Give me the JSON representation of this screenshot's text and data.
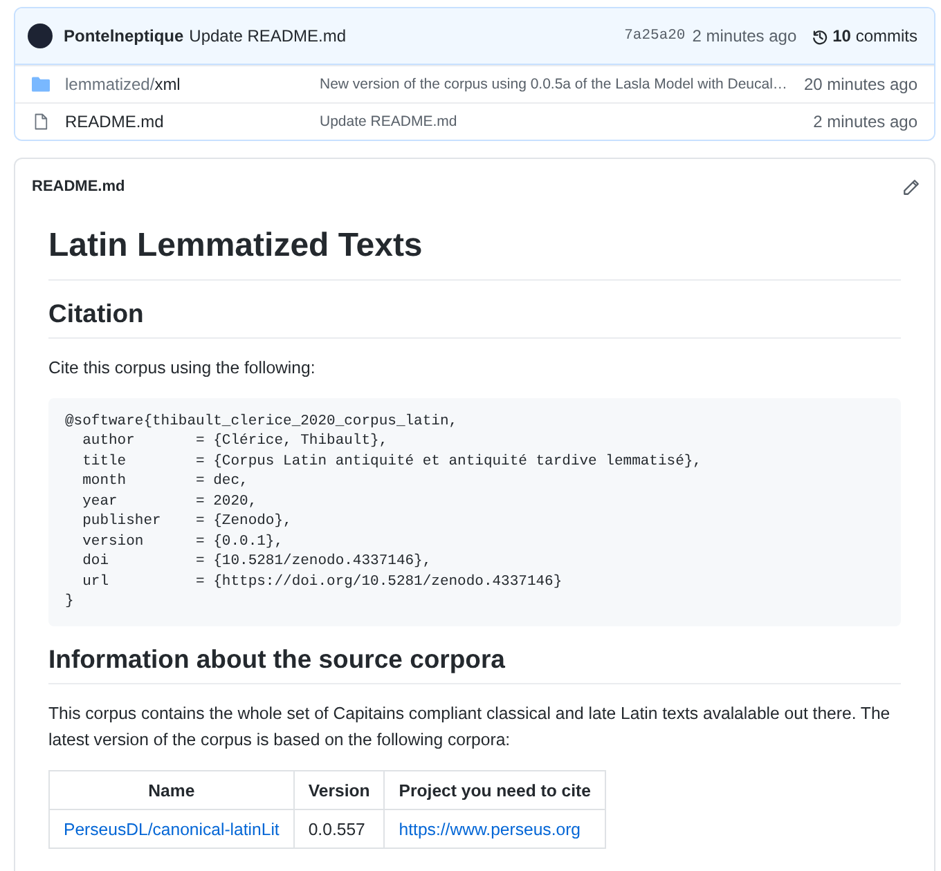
{
  "commit": {
    "author": "Pontelneptique",
    "message": "Update README.md",
    "hash": "7a25a20",
    "time": "2 minutes ago",
    "commits_count": "10",
    "commits_label": "commits"
  },
  "files": [
    {
      "kind": "folder",
      "prefix": "lemmatized/",
      "name": "xml",
      "message": "New version of the corpus using 0.0.5a of the Lasla Model with Deucal…",
      "time": "20 minutes ago"
    },
    {
      "kind": "file",
      "name": "README.md",
      "message": "Update README.md",
      "time": "2 minutes ago"
    }
  ],
  "readme": {
    "filename": "README.md",
    "title": "Latin Lemmatized Texts",
    "citation_heading": "Citation",
    "citation_intro": "Cite this corpus using the following:",
    "code_lines": [
      "@software{thibault_clerice_2020_corpus_latin,",
      "  author       = {Clérice, Thibault},",
      "  title        = {Corpus Latin antiquité et antiquité tardive lemmatisé},",
      "  month        = dec,",
      "  year         = 2020,",
      "  publisher    = {Zenodo},",
      "  version      = {0.0.1},",
      "  doi          = {10.5281/zenodo.4337146},",
      "  url          = {https://doi.org/10.5281/zenodo.4337146}",
      "}"
    ],
    "sources_heading": "Information about the source corpora",
    "sources_intro": "This corpus contains the whole set of Capitains compliant classical and late Latin texts avalalable out there. The latest version of the corpus is based on the following corpora:",
    "table": {
      "columns": [
        "Name",
        "Version",
        "Project you need to cite"
      ],
      "rows": [
        {
          "name": "PerseusDL/canonical-latinLit",
          "version": "0.0.557",
          "project": "https://www.perseus.org"
        }
      ]
    }
  }
}
